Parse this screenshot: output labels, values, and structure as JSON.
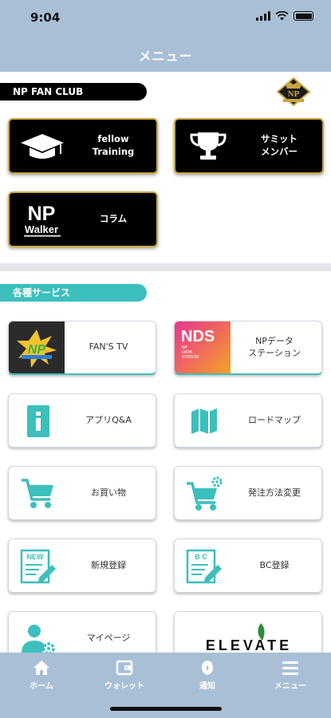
{
  "status_bar": {
    "time": "9:04"
  },
  "header": {
    "title": "メニュー"
  },
  "fan_club": {
    "section_label": "NP FAN CLUB",
    "logo_text": "NP",
    "items": [
      {
        "label": "fellow\nTraining",
        "icon": "graduation-cap-icon"
      },
      {
        "label": "サミット\nメンバー",
        "icon": "trophy-icon"
      },
      {
        "label": "コラム",
        "icon": "np-walker-logo",
        "logo_text_top": "NP",
        "logo_text_bottom": "Walker"
      }
    ]
  },
  "services": {
    "section_label": "各種サービス",
    "items": [
      {
        "label": "FAN'S TV",
        "icon": "fans-tv-logo",
        "logo_text": "NP"
      },
      {
        "label": "NPデータ\nステーション",
        "icon": "nds-logo",
        "logo_text": "NDS",
        "logo_sub": "NP\nDATA\nSTATION"
      },
      {
        "label": "アプリQ&A",
        "icon": "info-icon"
      },
      {
        "label": "ロードマップ",
        "icon": "map-icon"
      },
      {
        "label": "お買い物",
        "icon": "shopping-cart-icon"
      },
      {
        "label": "発注方法変更",
        "icon": "cart-settings-icon"
      },
      {
        "label": "新規登録",
        "icon": "new-register-icon",
        "badge": "NEW"
      },
      {
        "label": "BC登録",
        "icon": "bc-register-icon",
        "badge": "B C"
      },
      {
        "label": "マイページ",
        "icon": "user-settings-icon"
      },
      {
        "label": "",
        "icon": "elevate-logo",
        "logo_text": "ELEVATE"
      }
    ]
  },
  "tab_bar": {
    "items": [
      {
        "label": "ホーム",
        "icon": "home-icon"
      },
      {
        "label": "ウォレット",
        "icon": "wallet-icon"
      },
      {
        "label": "通知",
        "icon": "bell-icon"
      },
      {
        "label": "メニュー",
        "icon": "menu-icon"
      }
    ]
  },
  "colors": {
    "header_bg": "#a9bfd6",
    "accent": "#3cbfbd",
    "gold": "#c7a63f"
  }
}
